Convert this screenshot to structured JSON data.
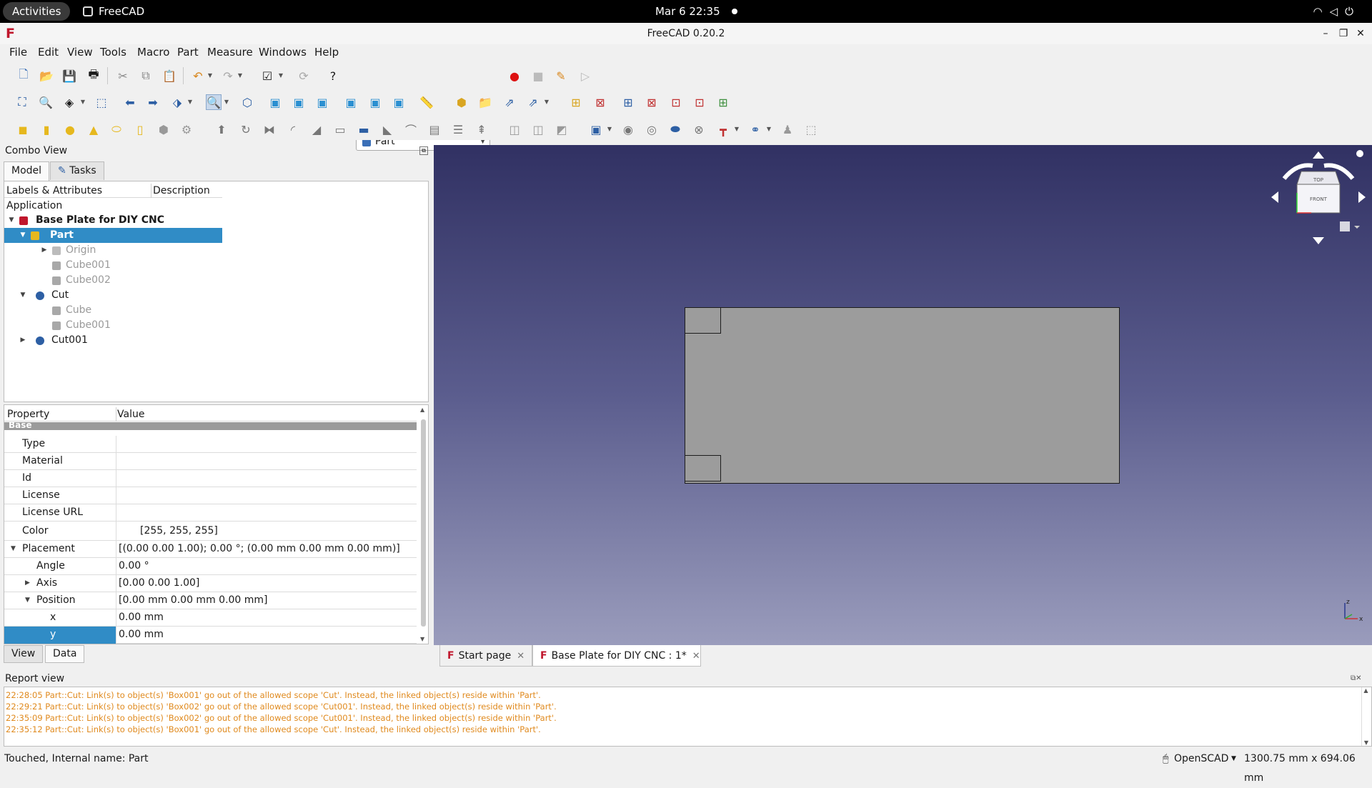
{
  "topbar": {
    "activities": "Activities",
    "app_name": "FreeCAD",
    "clock": "Mar 6  22:35"
  },
  "window": {
    "title": "FreeCAD 0.20.2"
  },
  "menu": [
    "File",
    "Edit",
    "View",
    "Tools",
    "Macro",
    "Part",
    "Measure",
    "Windows",
    "Help"
  ],
  "workbench": "Part",
  "combo": {
    "title": "Combo View",
    "tabs": [
      "Model",
      "Tasks"
    ],
    "tree_headers": [
      "Labels & Attributes",
      "Description"
    ],
    "tree": [
      {
        "label": "Application"
      },
      {
        "label": "Base Plate for DIY CNC"
      },
      {
        "label": "Part"
      },
      {
        "label": "Origin"
      },
      {
        "label": "Cube001"
      },
      {
        "label": "Cube002"
      },
      {
        "label": "Cut"
      },
      {
        "label": "Cube"
      },
      {
        "label": "Cube001"
      },
      {
        "label": "Cut001"
      }
    ],
    "prop_headers": [
      "Property",
      "Value"
    ],
    "group": "Base",
    "props": [
      {
        "k": "Type",
        "v": ""
      },
      {
        "k": "Material",
        "v": ""
      },
      {
        "k": "Id",
        "v": ""
      },
      {
        "k": "License",
        "v": ""
      },
      {
        "k": "License URL",
        "v": ""
      },
      {
        "k": "Color",
        "v": "[255, 255, 255]"
      },
      {
        "k": "Placement",
        "v": "[(0.00 0.00 1.00); 0.00 °; (0.00 mm  0.00 mm  0.00 mm)]"
      },
      {
        "k": "Angle",
        "v": "0.00 °"
      },
      {
        "k": "Axis",
        "v": "[0.00 0.00 1.00]"
      },
      {
        "k": "Position",
        "v": "[0.00 mm  0.00 mm  0.00 mm]"
      },
      {
        "k": "x",
        "v": "0.00 mm"
      },
      {
        "k": "y",
        "v": "0.00 mm"
      }
    ],
    "bottom_tabs": [
      "View",
      "Data"
    ]
  },
  "navcube": {
    "top": "TOP",
    "front": "FRONT"
  },
  "axes": {
    "z": "z",
    "x": "x"
  },
  "doc_tabs": [
    "Start page",
    "Base Plate for DIY CNC : 1*"
  ],
  "report": {
    "title": "Report view",
    "lines": [
      "22:28:05  Part::Cut: Link(s) to object(s) 'Box001' go out of the allowed scope 'Cut'. Instead, the linked object(s) reside within 'Part'.",
      "22:29:21  Part::Cut: Link(s) to object(s) 'Box002' go out of the allowed scope 'Cut001'. Instead, the linked object(s) reside within 'Part'.",
      "22:35:09  Part::Cut: Link(s) to object(s) 'Box002' go out of the allowed scope 'Cut001'. Instead, the linked object(s) reside within 'Part'.",
      "22:35:12  Part::Cut: Link(s) to object(s) 'Box001' go out of the allowed scope 'Cut'. Instead, the linked object(s) reside within 'Part'."
    ],
    "color": "#e08a1e"
  },
  "status": {
    "left": "Touched, Internal name: Part",
    "nav_style": "OpenSCAD",
    "dimensions": "1300.75 mm x 694.06 mm"
  },
  "colors": {
    "selection": "#308cc6",
    "view_top": "#313163",
    "view_bottom": "#9a9cbc",
    "plate": "#9c9c9c"
  }
}
